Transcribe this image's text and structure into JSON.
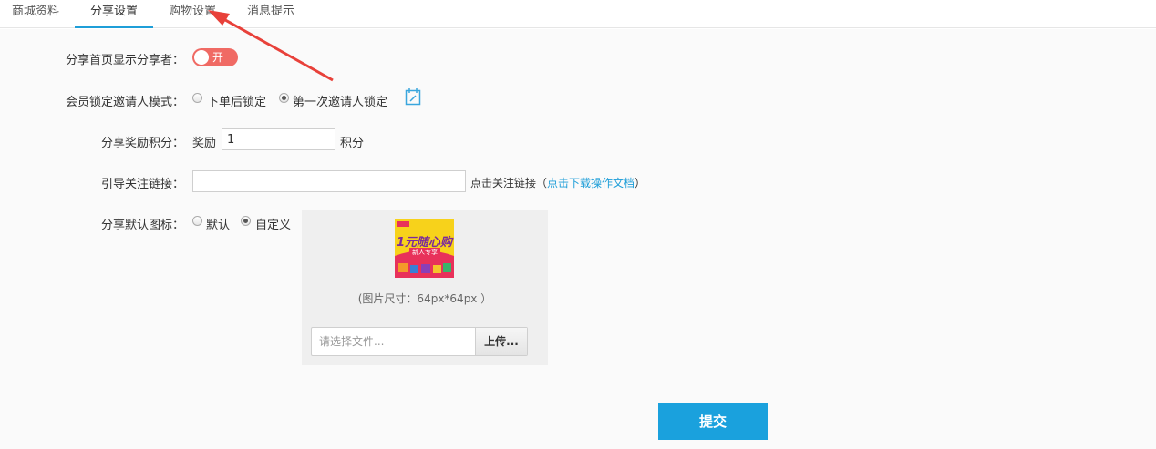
{
  "tabs": [
    {
      "label": "商城资料"
    },
    {
      "label": "分享设置",
      "active": true
    },
    {
      "label": "购物设置"
    },
    {
      "label": "消息提示"
    }
  ],
  "form": {
    "show_sharer": {
      "label": "分享首页显示分享者：",
      "toggle_text": "开",
      "on": true
    },
    "lock_mode": {
      "label": "会员锁定邀请人模式：",
      "options": [
        {
          "label": "下单后锁定",
          "checked": false
        },
        {
          "label": "第一次邀请人锁定",
          "checked": true
        }
      ]
    },
    "share_reward": {
      "label": "分享奖励积分：",
      "prefix": "奖励",
      "value": "1",
      "suffix": "积分"
    },
    "follow_link": {
      "label": "引导关注链接：",
      "value": "",
      "hint": "点击关注链接",
      "paren_open": "（",
      "link_text": "点击下载操作文档",
      "paren_close": "）"
    },
    "default_icon": {
      "label": "分享默认图标：",
      "options": [
        {
          "label": "默认",
          "checked": false
        },
        {
          "label": "自定义",
          "checked": true
        }
      ],
      "image_alt_text": "1元随心购",
      "image_subtext": "新人专享",
      "size_note": "(图片尺寸：64px*64px ）",
      "file_placeholder": "请选择文件...",
      "upload_label": "上传..."
    }
  },
  "submit_label": "提交",
  "colors": {
    "accent": "#1aa1dd",
    "toggle_on": "#f06a64",
    "annotation_arrow": "#e8413a"
  },
  "icons": {
    "calendar": "calendar-edit-icon",
    "arrow": "annotation-arrow"
  }
}
